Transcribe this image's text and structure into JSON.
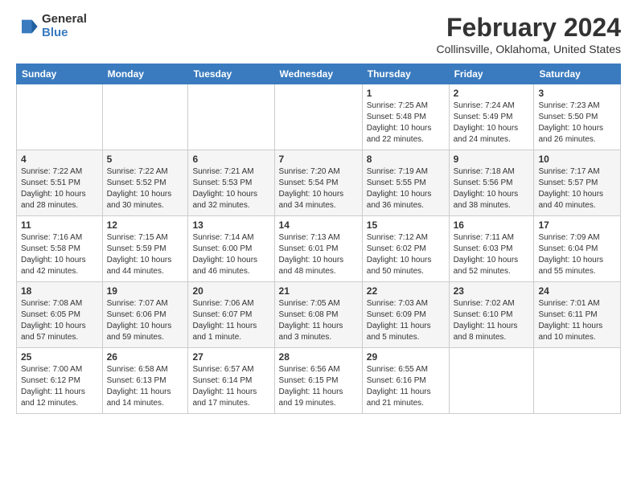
{
  "header": {
    "logo": {
      "general": "General",
      "blue": "Blue"
    },
    "title": "February 2024",
    "subtitle": "Collinsville, Oklahoma, United States"
  },
  "calendar": {
    "days_of_week": [
      "Sunday",
      "Monday",
      "Tuesday",
      "Wednesday",
      "Thursday",
      "Friday",
      "Saturday"
    ],
    "weeks": [
      [
        {
          "day": "",
          "info": ""
        },
        {
          "day": "",
          "info": ""
        },
        {
          "day": "",
          "info": ""
        },
        {
          "day": "",
          "info": ""
        },
        {
          "day": "1",
          "info": "Sunrise: 7:25 AM\nSunset: 5:48 PM\nDaylight: 10 hours and 22 minutes."
        },
        {
          "day": "2",
          "info": "Sunrise: 7:24 AM\nSunset: 5:49 PM\nDaylight: 10 hours and 24 minutes."
        },
        {
          "day": "3",
          "info": "Sunrise: 7:23 AM\nSunset: 5:50 PM\nDaylight: 10 hours and 26 minutes."
        }
      ],
      [
        {
          "day": "4",
          "info": "Sunrise: 7:22 AM\nSunset: 5:51 PM\nDaylight: 10 hours and 28 minutes."
        },
        {
          "day": "5",
          "info": "Sunrise: 7:22 AM\nSunset: 5:52 PM\nDaylight: 10 hours and 30 minutes."
        },
        {
          "day": "6",
          "info": "Sunrise: 7:21 AM\nSunset: 5:53 PM\nDaylight: 10 hours and 32 minutes."
        },
        {
          "day": "7",
          "info": "Sunrise: 7:20 AM\nSunset: 5:54 PM\nDaylight: 10 hours and 34 minutes."
        },
        {
          "day": "8",
          "info": "Sunrise: 7:19 AM\nSunset: 5:55 PM\nDaylight: 10 hours and 36 minutes."
        },
        {
          "day": "9",
          "info": "Sunrise: 7:18 AM\nSunset: 5:56 PM\nDaylight: 10 hours and 38 minutes."
        },
        {
          "day": "10",
          "info": "Sunrise: 7:17 AM\nSunset: 5:57 PM\nDaylight: 10 hours and 40 minutes."
        }
      ],
      [
        {
          "day": "11",
          "info": "Sunrise: 7:16 AM\nSunset: 5:58 PM\nDaylight: 10 hours and 42 minutes."
        },
        {
          "day": "12",
          "info": "Sunrise: 7:15 AM\nSunset: 5:59 PM\nDaylight: 10 hours and 44 minutes."
        },
        {
          "day": "13",
          "info": "Sunrise: 7:14 AM\nSunset: 6:00 PM\nDaylight: 10 hours and 46 minutes."
        },
        {
          "day": "14",
          "info": "Sunrise: 7:13 AM\nSunset: 6:01 PM\nDaylight: 10 hours and 48 minutes."
        },
        {
          "day": "15",
          "info": "Sunrise: 7:12 AM\nSunset: 6:02 PM\nDaylight: 10 hours and 50 minutes."
        },
        {
          "day": "16",
          "info": "Sunrise: 7:11 AM\nSunset: 6:03 PM\nDaylight: 10 hours and 52 minutes."
        },
        {
          "day": "17",
          "info": "Sunrise: 7:09 AM\nSunset: 6:04 PM\nDaylight: 10 hours and 55 minutes."
        }
      ],
      [
        {
          "day": "18",
          "info": "Sunrise: 7:08 AM\nSunset: 6:05 PM\nDaylight: 10 hours and 57 minutes."
        },
        {
          "day": "19",
          "info": "Sunrise: 7:07 AM\nSunset: 6:06 PM\nDaylight: 10 hours and 59 minutes."
        },
        {
          "day": "20",
          "info": "Sunrise: 7:06 AM\nSunset: 6:07 PM\nDaylight: 11 hours and 1 minute."
        },
        {
          "day": "21",
          "info": "Sunrise: 7:05 AM\nSunset: 6:08 PM\nDaylight: 11 hours and 3 minutes."
        },
        {
          "day": "22",
          "info": "Sunrise: 7:03 AM\nSunset: 6:09 PM\nDaylight: 11 hours and 5 minutes."
        },
        {
          "day": "23",
          "info": "Sunrise: 7:02 AM\nSunset: 6:10 PM\nDaylight: 11 hours and 8 minutes."
        },
        {
          "day": "24",
          "info": "Sunrise: 7:01 AM\nSunset: 6:11 PM\nDaylight: 11 hours and 10 minutes."
        }
      ],
      [
        {
          "day": "25",
          "info": "Sunrise: 7:00 AM\nSunset: 6:12 PM\nDaylight: 11 hours and 12 minutes."
        },
        {
          "day": "26",
          "info": "Sunrise: 6:58 AM\nSunset: 6:13 PM\nDaylight: 11 hours and 14 minutes."
        },
        {
          "day": "27",
          "info": "Sunrise: 6:57 AM\nSunset: 6:14 PM\nDaylight: 11 hours and 17 minutes."
        },
        {
          "day": "28",
          "info": "Sunrise: 6:56 AM\nSunset: 6:15 PM\nDaylight: 11 hours and 19 minutes."
        },
        {
          "day": "29",
          "info": "Sunrise: 6:55 AM\nSunset: 6:16 PM\nDaylight: 11 hours and 21 minutes."
        },
        {
          "day": "",
          "info": ""
        },
        {
          "day": "",
          "info": ""
        }
      ]
    ]
  }
}
